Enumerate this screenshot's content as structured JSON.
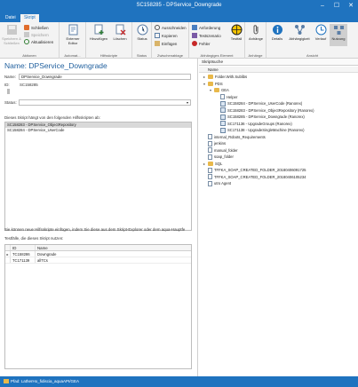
{
  "window": {
    "title": "SC158285 - DPService_Downgrade"
  },
  "menu": {
    "tabs": [
      "Datei",
      "Skript"
    ],
    "active": "Skript"
  },
  "ribbon": {
    "aktionen": {
      "group_label": "Aktionen",
      "save_close": "Speichern & Schließen",
      "close": "Schließen",
      "save": "Speichern",
      "refresh": "Aktualisieren"
    },
    "automat": {
      "group_label": "Automat...",
      "external_editor": "Externer Editor"
    },
    "hilfsskripte": {
      "group_label": "Hilfsskripte",
      "add": "Hinzufügen",
      "delete": "Löschen"
    },
    "status": {
      "group_label": "Status",
      "status": "Status"
    },
    "zwischenablage": {
      "group_label": "Zwischenablage",
      "cut": "Ausschneiden",
      "copy": "Kopieren",
      "paste": "Einfügen"
    },
    "abhaengiges": {
      "group_label": "Abhängiges Element",
      "requirement": "Anforderung",
      "testscenario": "Testszenario",
      "error": "Fehler",
      "testfall": "Testfall"
    },
    "anhaenge": {
      "group_label": "Anhänge",
      "attachments": "Anhänge"
    },
    "ansicht": {
      "group_label": "Ansicht",
      "details": "Details",
      "dependency": "Abhängigkeit",
      "history": "Verlauf",
      "usage": "Nutzung"
    }
  },
  "detail": {
    "heading": "Name: DPService_Downgrade",
    "name_label": "Name:",
    "name_value": "DPService_Downgrade",
    "id_label": "ID:",
    "id_value": "SC158285",
    "status_label": "Status:",
    "status_value": "",
    "dependencies_caption": "Dieses Skript hängt von den folgenden Hilfsskripten ab:",
    "dependencies": [
      "SC158283 - DPService_ObjectRepository",
      "SC158284 - DPService_UserCode"
    ],
    "add_info": "Sie können neue Hilfsskripte einfügen, indem Sie diese aus dem Skript-Explorer oder dem aqua-Hauptfe",
    "testcases_caption": "Testfälle, die dieses Skript nutzen:",
    "grid_headers": [
      "ID",
      "Name"
    ],
    "testcases": [
      {
        "marker": "▸",
        "id": "TC158286",
        "name": "Downgrade"
      },
      {
        "marker": "",
        "id": "TC171139",
        "name": "allTCs"
      }
    ]
  },
  "explorer": {
    "tab_title": "Skriptsuche",
    "column_header": "Name",
    "nodes": [
      {
        "label": "Folder.With.Sublibs",
        "icon": "folder",
        "exp": "▸",
        "level": 0
      },
      {
        "label": "PDS",
        "icon": "folder",
        "exp": "▾",
        "level": 0
      },
      {
        "label": "GEA",
        "icon": "folder",
        "exp": "▾",
        "level": 1
      },
      {
        "label": "Helper",
        "icon": "doc",
        "exp": "",
        "level": 2
      },
      {
        "label": "SC158284 - DPService_UserCode (Ranorex)",
        "icon": "script",
        "exp": "",
        "level": 2
      },
      {
        "label": "SC158283 - DPService_ObjectRepository (Ranorex)",
        "icon": "script",
        "exp": "",
        "level": 2
      },
      {
        "label": "SC158285 - DPService_Downgrade (Ranorex)",
        "icon": "script",
        "exp": "",
        "level": 2
      },
      {
        "label": "SC171136 - UpgradeGroups (Ranorex)",
        "icon": "script",
        "exp": "",
        "level": 2
      },
      {
        "label": "SC171138 - UpgradeSingleMachine (Ranorex)",
        "icon": "script",
        "exp": "",
        "level": 2
      },
      {
        "label": "internal_Robots_Requirements",
        "icon": "doc",
        "exp": "",
        "level": 0
      },
      {
        "label": "jenkins",
        "icon": "doc",
        "exp": "",
        "level": 0
      },
      {
        "label": "manual_folder",
        "icon": "doc",
        "exp": "",
        "level": 0
      },
      {
        "label": "soap_folder",
        "icon": "doc",
        "exp": "",
        "level": 0
      },
      {
        "label": "SQL",
        "icon": "folder",
        "exp": "▸",
        "level": 0
      },
      {
        "label": "TFFKA_SOAP_CREATED_FOLDER_20180406091725",
        "icon": "doc",
        "exp": "",
        "level": 0
      },
      {
        "label": "TFFKA_SOAP_CREATED_FOLDER_20180406105234",
        "icon": "doc",
        "exp": "",
        "level": 0
      },
      {
        "label": "utro Agent",
        "icon": "doc",
        "exp": "",
        "level": 0
      }
    ]
  },
  "statusbar": {
    "path": "Pfad: LatherHo_fidiscia_aquaAPI/GEA"
  }
}
